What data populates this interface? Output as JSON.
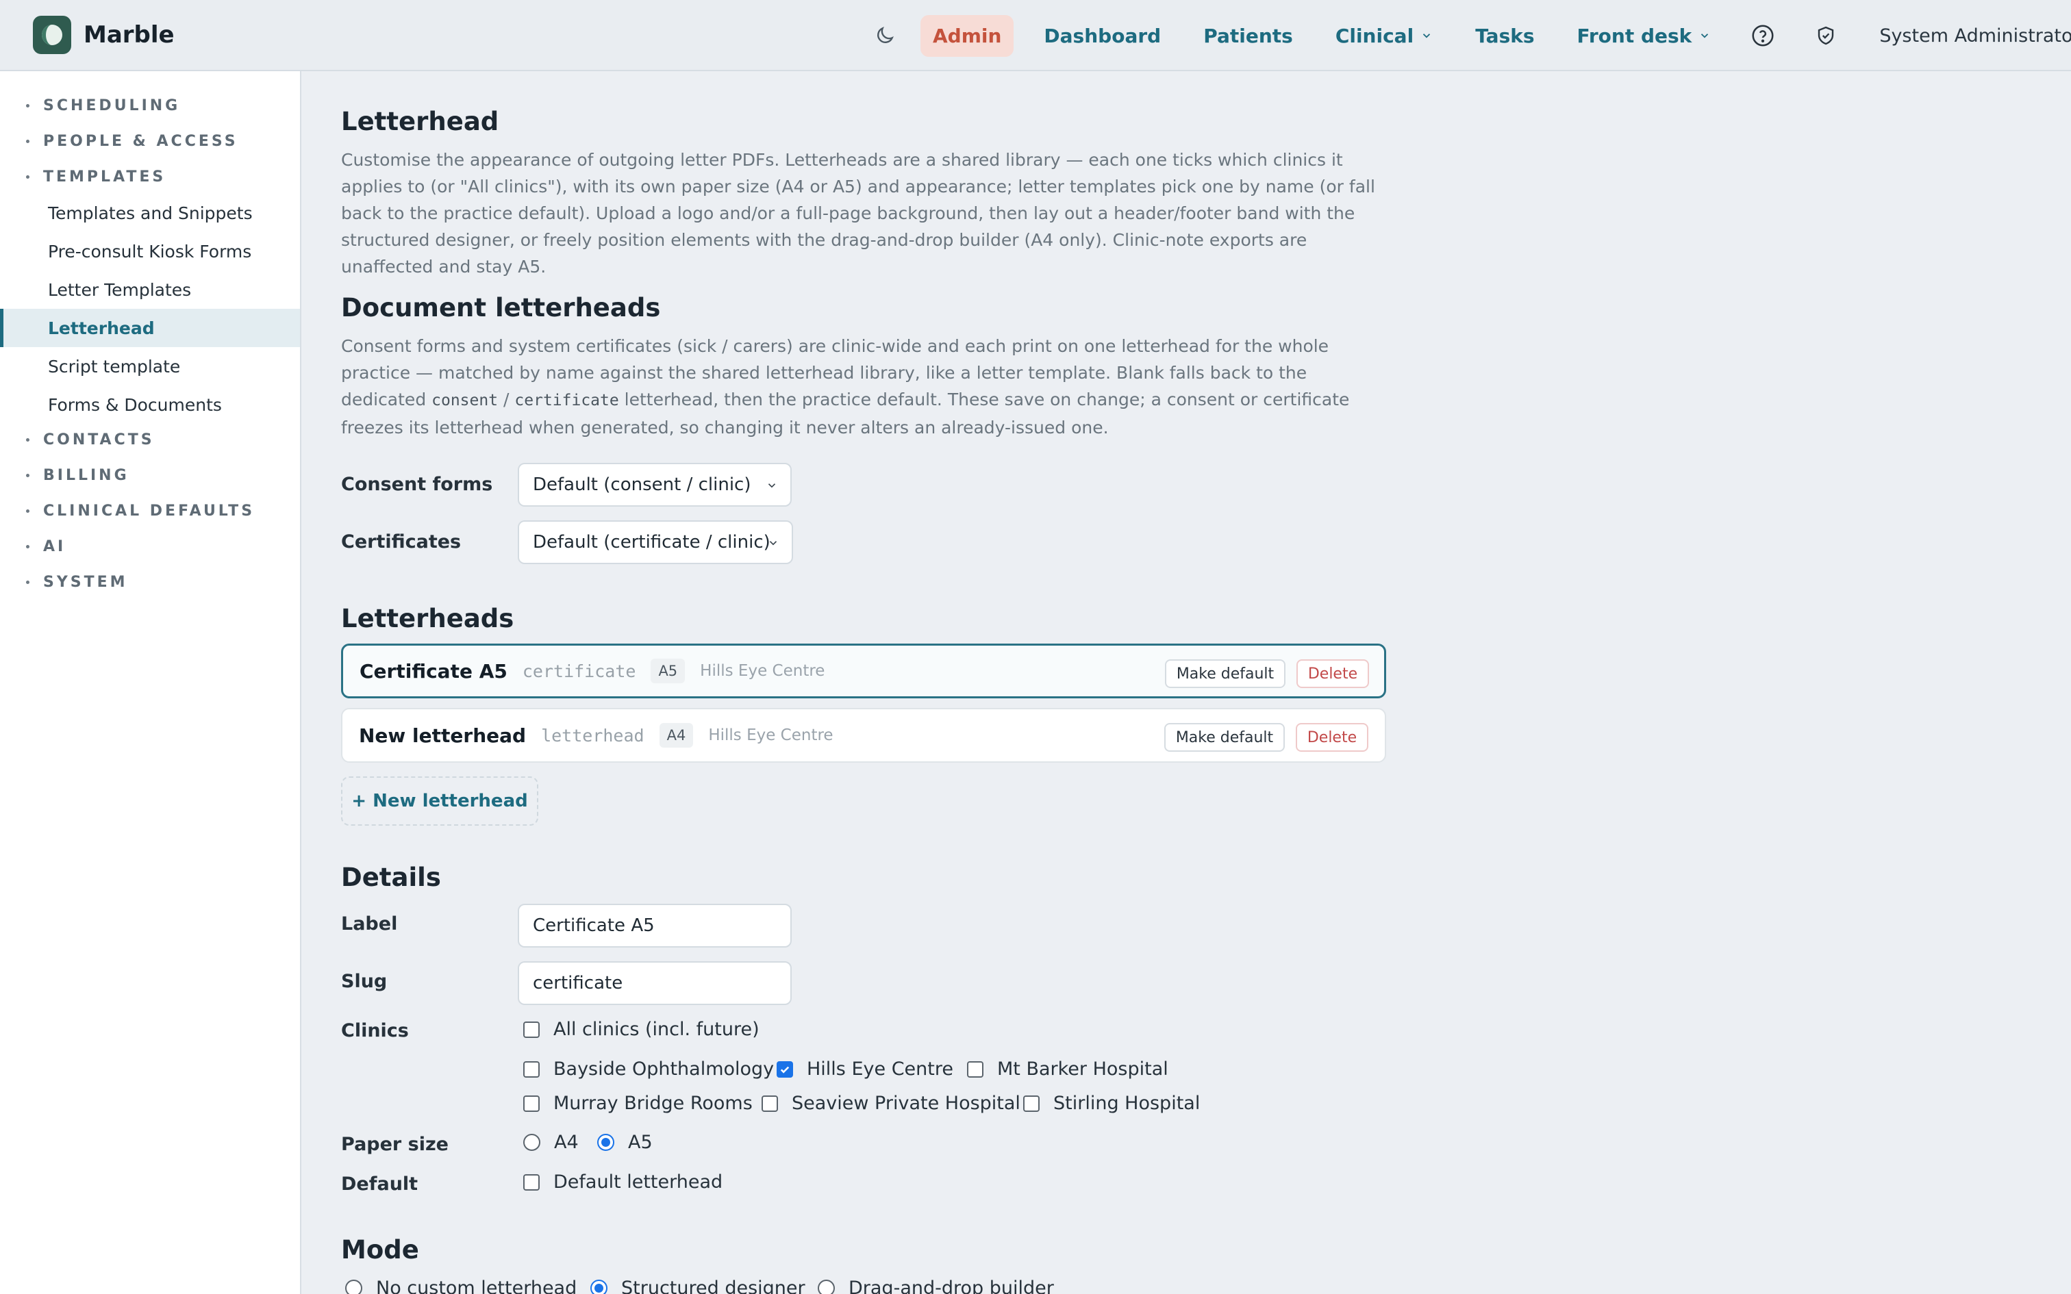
{
  "app": {
    "name": "Marble"
  },
  "nav": {
    "items": [
      {
        "label": "Admin",
        "active": true
      },
      {
        "label": "Dashboard"
      },
      {
        "label": "Patients"
      },
      {
        "label": "Clinical",
        "dropdown": true
      },
      {
        "label": "Tasks"
      },
      {
        "label": "Front desk",
        "dropdown": true
      }
    ],
    "icons": [
      "moon-icon",
      "help-icon",
      "shield-check-icon"
    ],
    "user": "System Administrator"
  },
  "sidebar": {
    "groups": [
      "SCHEDULING",
      "PEOPLE & ACCESS",
      "TEMPLATES",
      "CONTACTS",
      "BILLING",
      "CLINICAL DEFAULTS",
      "AI",
      "SYSTEM"
    ],
    "template_items": [
      "Templates and Snippets",
      "Pre-consult Kiosk Forms",
      "Letter Templates",
      "Letterhead",
      "Script template",
      "Forms & Documents"
    ],
    "active_item": "Letterhead"
  },
  "letterhead_section": {
    "title": "Letterhead",
    "description": "Customise the appearance of outgoing letter PDFs. Letterheads are a shared library — each one ticks which clinics it applies to (or \"All clinics\"), with its own paper size (A4 or A5) and appearance; letter templates pick one by name (or fall back to the practice default). Upload a logo and/or a full-page background, then lay out a header/footer band with the structured designer, or freely position elements with the drag-and-drop builder (A4 only). Clinic-note exports are unaffected and stay A5."
  },
  "document_letterheads": {
    "title": "Document letterheads",
    "description_parts": [
      "Consent forms and system certificates (sick / carers) are clinic-wide and each print on one letterhead for the whole practice — matched by name against the shared letterhead library, like a letter template. Blank falls back to the dedicated ",
      "consent",
      " / ",
      "certificate",
      " letterhead, then the practice default. These save on change; a consent or certificate freezes its letterhead when generated, so changing it never alters an already-issued one."
    ],
    "consent_label": "Consent forms",
    "consent_value": "Default (consent / clinic)",
    "certificates_label": "Certificates",
    "certificates_value": "Default (certificate / clinic)"
  },
  "letterheads": {
    "title": "Letterheads",
    "rows": [
      {
        "name": "Certificate A5",
        "slug": "certificate",
        "size": "A5",
        "clinic": "Hills Eye Centre",
        "selected": true
      },
      {
        "name": "New letterhead",
        "slug": "letterhead",
        "size": "A4",
        "clinic": "Hills Eye Centre",
        "selected": false
      }
    ],
    "make_default_label": "Make default",
    "delete_label": "Delete",
    "new_label": "+ New letterhead"
  },
  "details": {
    "title": "Details",
    "label_label": "Label",
    "label_value": "Certificate A5",
    "slug_label": "Slug",
    "slug_value": "certificate",
    "clinics_label": "Clinics",
    "all_clinics": {
      "label": "All clinics (incl. future)",
      "checked": false
    },
    "clinics": [
      {
        "label": "Bayside Ophthalmology",
        "checked": false
      },
      {
        "label": "Hills Eye Centre",
        "checked": true
      },
      {
        "label": "Mt Barker Hospital",
        "checked": false
      },
      {
        "label": "Murray Bridge Rooms",
        "checked": false
      },
      {
        "label": "Seaview Private Hospital",
        "checked": false
      },
      {
        "label": "Stirling Hospital",
        "checked": false
      }
    ],
    "paper_size_label": "Paper size",
    "paper_sizes": [
      {
        "label": "A4",
        "selected": false
      },
      {
        "label": "A5",
        "selected": true
      }
    ],
    "default_label": "Default",
    "default_checkbox": {
      "label": "Default letterhead",
      "checked": false
    }
  },
  "mode": {
    "title": "Mode",
    "options": [
      {
        "label": "No custom letterhead",
        "selected": false
      },
      {
        "label": "Structured designer",
        "selected": true
      },
      {
        "label": "Drag-and-drop builder",
        "selected": false
      }
    ]
  },
  "colors": {
    "accent": "#1d6b80",
    "admin_bg": "#f7dcd6",
    "admin_text": "#c4523c",
    "danger": "#c24949",
    "checkbox": "#1a73e8"
  }
}
